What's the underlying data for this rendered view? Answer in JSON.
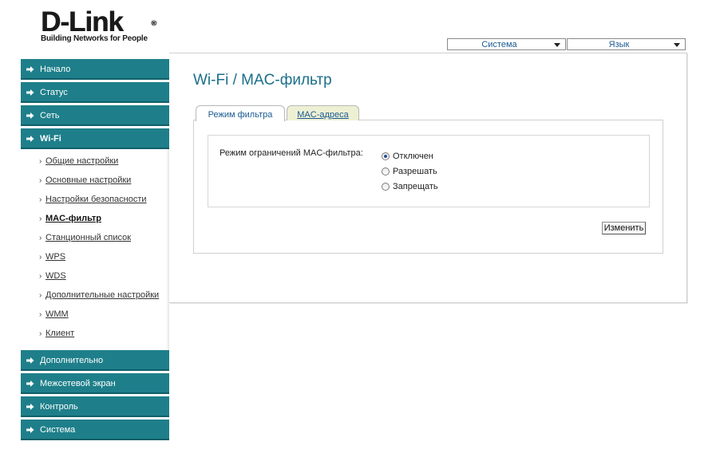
{
  "logo": {
    "brand": "D-Link",
    "reg_mark": "®",
    "tagline": "Building Networks for People"
  },
  "top_controls": {
    "system_label": "Система",
    "language_label": "Язык"
  },
  "sidebar": {
    "main_items_top": [
      {
        "label": "Начало"
      },
      {
        "label": "Статус"
      },
      {
        "label": "Сеть"
      },
      {
        "label": "Wi-Fi",
        "active": true
      }
    ],
    "wifi_subitems": [
      {
        "label": "Общие настройки"
      },
      {
        "label": "Основные настройки"
      },
      {
        "label": "Настройки безопасности"
      },
      {
        "label": "MAC-фильтр",
        "current": true
      },
      {
        "label": "Станционный список"
      },
      {
        "label": "WPS"
      },
      {
        "label": "WDS"
      },
      {
        "label": "Дополнительные настройки"
      },
      {
        "label": "WMM"
      },
      {
        "label": "Клиент"
      }
    ],
    "main_items_bottom": [
      {
        "label": "Дополнительно"
      },
      {
        "label": "Межсетевой экран"
      },
      {
        "label": "Контроль"
      },
      {
        "label": "Система"
      }
    ]
  },
  "main": {
    "title": "Wi-Fi  / MAC-фильтр",
    "tabs": [
      {
        "label": "Режим фильтра",
        "selected": true
      },
      {
        "label": "MAC-адреса",
        "selected": false
      }
    ],
    "field_label": "Режим ограничений MAC-фильтра:",
    "radio_options": [
      {
        "label": "Отключен",
        "checked": true
      },
      {
        "label": "Разрешать",
        "checked": false
      },
      {
        "label": "Запрещать",
        "checked": false
      }
    ],
    "submit_label": "Изменить"
  },
  "colors": {
    "nav_bg": "#1e7f8a",
    "title_color": "#1a6f8a",
    "link_color": "#1a5a92",
    "tab_inactive_bg": "#eef0d4"
  }
}
